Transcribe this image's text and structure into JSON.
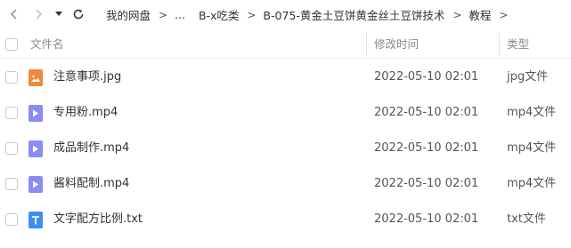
{
  "nav": {
    "back_icon": "chevron-left-icon",
    "forward_icon": "chevron-right-icon",
    "dropdown_icon": "triangle-down-icon",
    "refresh_icon": "refresh-icon"
  },
  "breadcrumb": {
    "items": [
      "我的网盘",
      "...",
      "B-x吃类",
      "B-075-黄金土豆饼黄金丝土豆饼技术",
      "教程"
    ],
    "separator": ">"
  },
  "header": {
    "name_label": "文件名",
    "modified_label": "修改时间",
    "type_label": "类型"
  },
  "colors": {
    "image_icon": "#f0883e",
    "video_icon": "#8a8cf0",
    "text_icon": "#3b8ff3"
  },
  "files": [
    {
      "name": "注意事项.jpg",
      "modified": "2022-05-10 02:01",
      "type": "jpg文件",
      "icon": "image-file-icon"
    },
    {
      "name": "专用粉.mp4",
      "modified": "2022-05-10 02:01",
      "type": "mp4文件",
      "icon": "video-file-icon"
    },
    {
      "name": "成品制作.mp4",
      "modified": "2022-05-10 02:01",
      "type": "mp4文件",
      "icon": "video-file-icon"
    },
    {
      "name": "酱料配制.mp4",
      "modified": "2022-05-10 02:01",
      "type": "mp4文件",
      "icon": "video-file-icon"
    },
    {
      "name": "文字配方比例.txt",
      "modified": "2022-05-10 02:01",
      "type": "txt文件",
      "icon": "text-file-icon"
    }
  ]
}
